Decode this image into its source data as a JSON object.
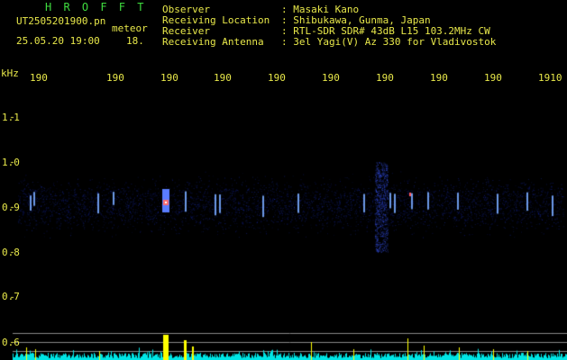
{
  "header": {
    "title": "H R O F F T",
    "filename": "UT2505201900.pn",
    "tag": "meteor",
    "datetime": "25.05.20 19:00",
    "counter": "18.",
    "fields": [
      {
        "label": "Observer",
        "value": ": Masaki Kano"
      },
      {
        "label": "Receiving Location",
        "value": ": Shibukawa, Gunma, Japan"
      },
      {
        "label": "Receiver",
        "value": ": RTL-SDR SDR# 43dB L15 103.2MHz CW"
      },
      {
        "label": "Receiving Antenna",
        "value": ": 3el Yagi(V) Az 330 for Vladivostok"
      }
    ]
  },
  "axes": {
    "y_unit": "kHz",
    "y_ticks": [
      "1.1",
      "1.0",
      "0.9",
      "0.8",
      "0.7",
      "0.6"
    ],
    "x_ticks": [
      "190",
      "190",
      "190",
      "190",
      "190",
      "190",
      "190",
      "190",
      "190",
      "1910"
    ]
  },
  "colors": {
    "label": "#e8e84a",
    "title": "#3fdc3f",
    "background": "#000000",
    "echo": "#3355ff",
    "bar": "#ffff00",
    "noise": "#00ffff"
  }
}
